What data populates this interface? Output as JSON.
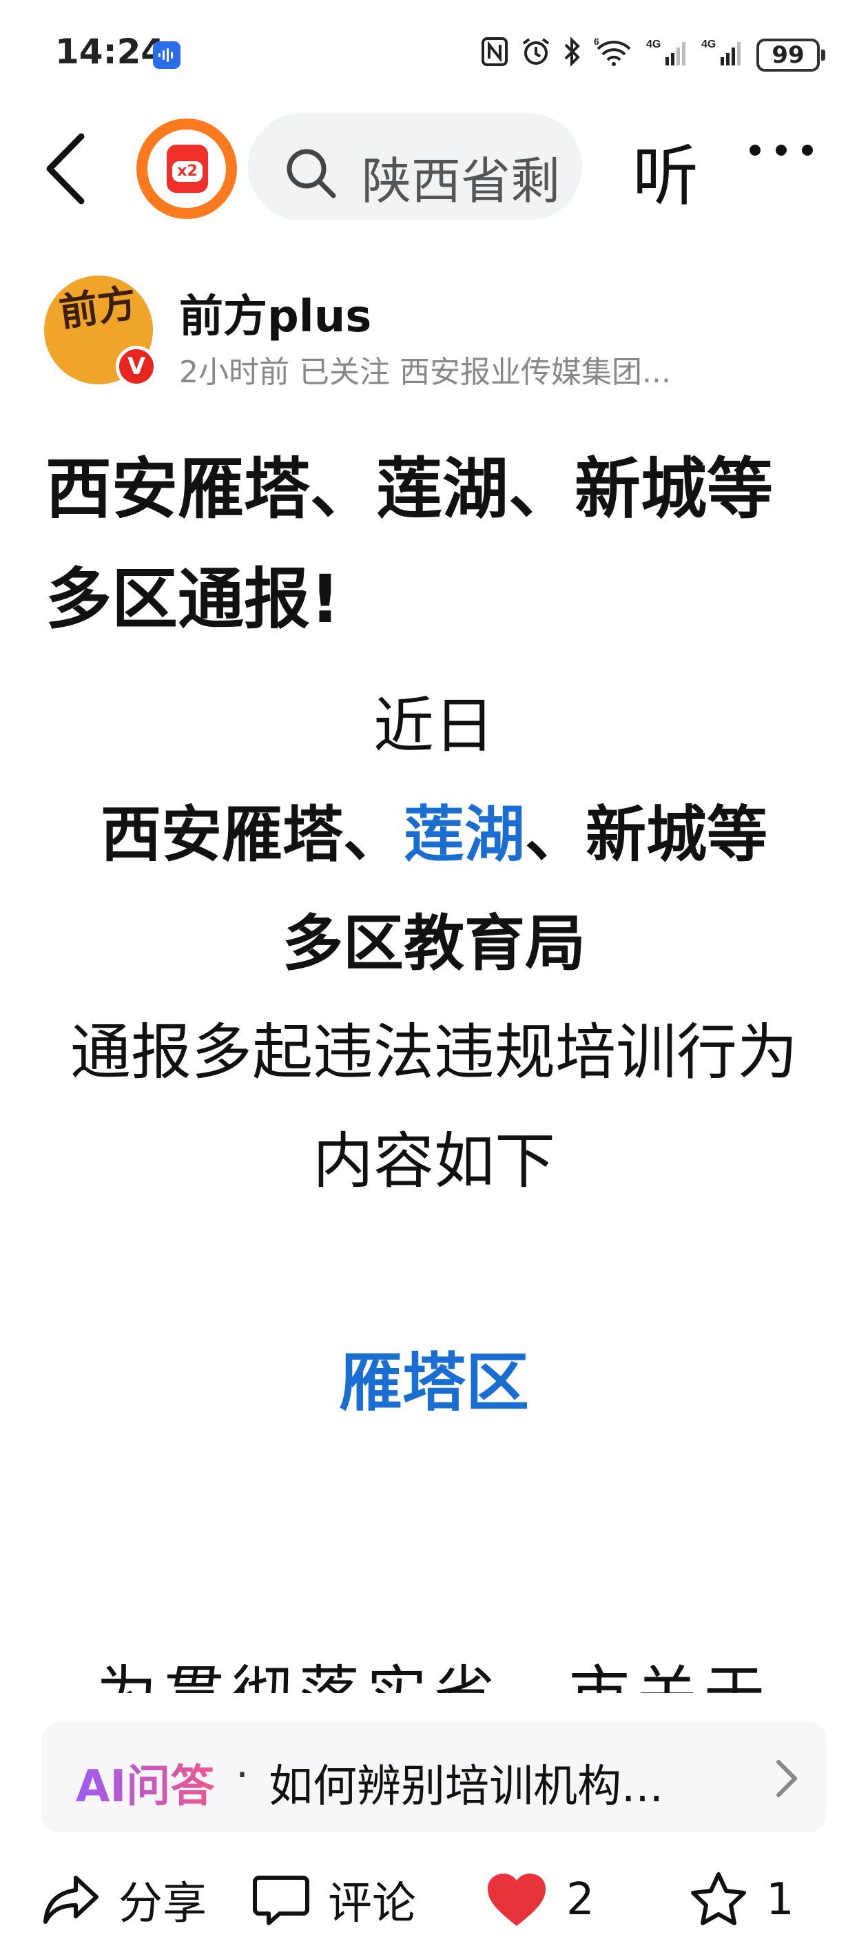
{
  "status_bar": {
    "time": "14:24",
    "battery": "99",
    "network_1": "4G",
    "network_2": "4G",
    "wifi_superscript": "6"
  },
  "nav": {
    "hongbao_badge": "x2",
    "search_text": "陕西省剩",
    "listen_label": "听"
  },
  "author": {
    "avatar_text": "前方",
    "verified_mark": "V",
    "name": "前方plus",
    "meta": "2小时前  已关注  西安报业传媒集团..."
  },
  "article": {
    "title": "西安雁塔、莲湖、新城等多区通报!",
    "line_1": "近日",
    "line_2_a": "西安雁塔、",
    "line_2_b": "莲湖",
    "line_2_c": "、新城等",
    "line_3": "多区教育局",
    "line_4": "通报多起违法违规培训行为",
    "line_5": "内容如下",
    "section_heading": "雁塔区",
    "cut_line": "为贯彻落实省、市关于"
  },
  "ai_qa": {
    "label": "AI问答",
    "dot": "·",
    "question": "如何辨别培训机构..."
  },
  "bottom_bar": {
    "share_label": "分享",
    "comment_label": "评论",
    "like_count": "2",
    "favorite_count": "1"
  },
  "colors": {
    "accent_blue": "#1a6dd1",
    "like_red": "#e8323c",
    "ai_gradient_start": "#9c5cf3",
    "ai_gradient_end": "#f0568c"
  }
}
